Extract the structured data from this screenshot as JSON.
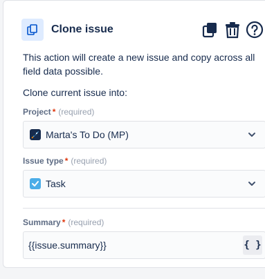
{
  "header": {
    "title": "Clone issue",
    "icons": [
      "clone-icon",
      "duplicate-icon",
      "delete-icon",
      "help-icon"
    ]
  },
  "description": "This action will create a new issue and copy across all field data possible.",
  "subheading": "Clone current issue into:",
  "fields": {
    "project": {
      "label": "Project",
      "required_star": "*",
      "required_text": "(required)",
      "value": "Marta's To Do (MP)",
      "icon": "rocket-project-icon"
    },
    "issue_type": {
      "label": "Issue type",
      "required_star": "*",
      "required_text": "(required)",
      "value": "Task",
      "icon": "task-checkbox-icon"
    },
    "summary": {
      "label": "Summary",
      "required_star": "*",
      "required_text": "(required)",
      "value": "{{issue.summary}}",
      "smart_value_button": "{ }"
    }
  },
  "colors": {
    "accent": "#0052cc",
    "icon_bg": "#deebff",
    "required": "#de350b",
    "task": "#4bade8"
  }
}
